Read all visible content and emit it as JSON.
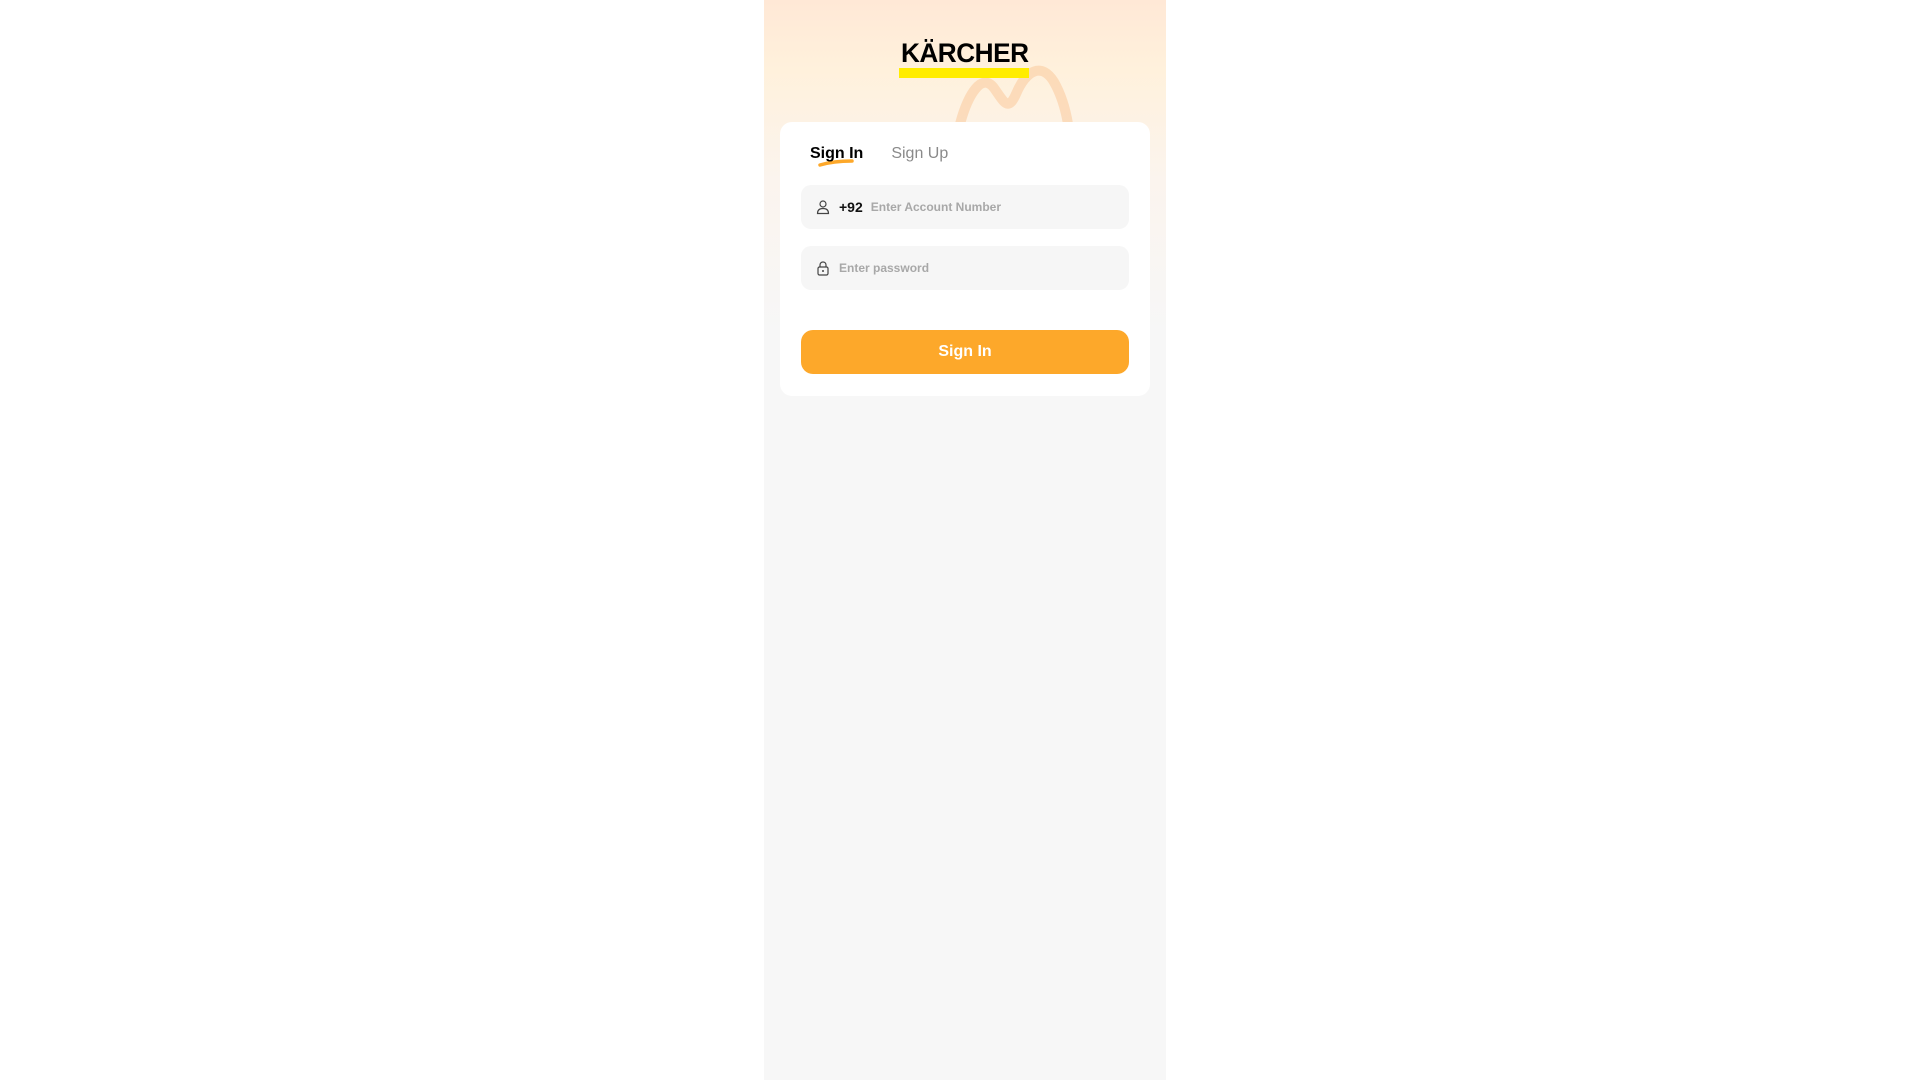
{
  "brand": {
    "logo_text": "KÄRCHER",
    "accent_color": "#fda82a",
    "logo_bar_color": "#ffed00"
  },
  "tabs": [
    {
      "label": "Sign In",
      "active": true
    },
    {
      "label": "Sign Up",
      "active": false
    }
  ],
  "form": {
    "phone_prefix": "+92",
    "account_placeholder": "Enter Account Number",
    "account_value": "",
    "password_placeholder": "Enter password",
    "password_value": "",
    "account_icon": "user-icon",
    "password_icon": "lock-icon"
  },
  "submit": {
    "label": "Sign In"
  }
}
